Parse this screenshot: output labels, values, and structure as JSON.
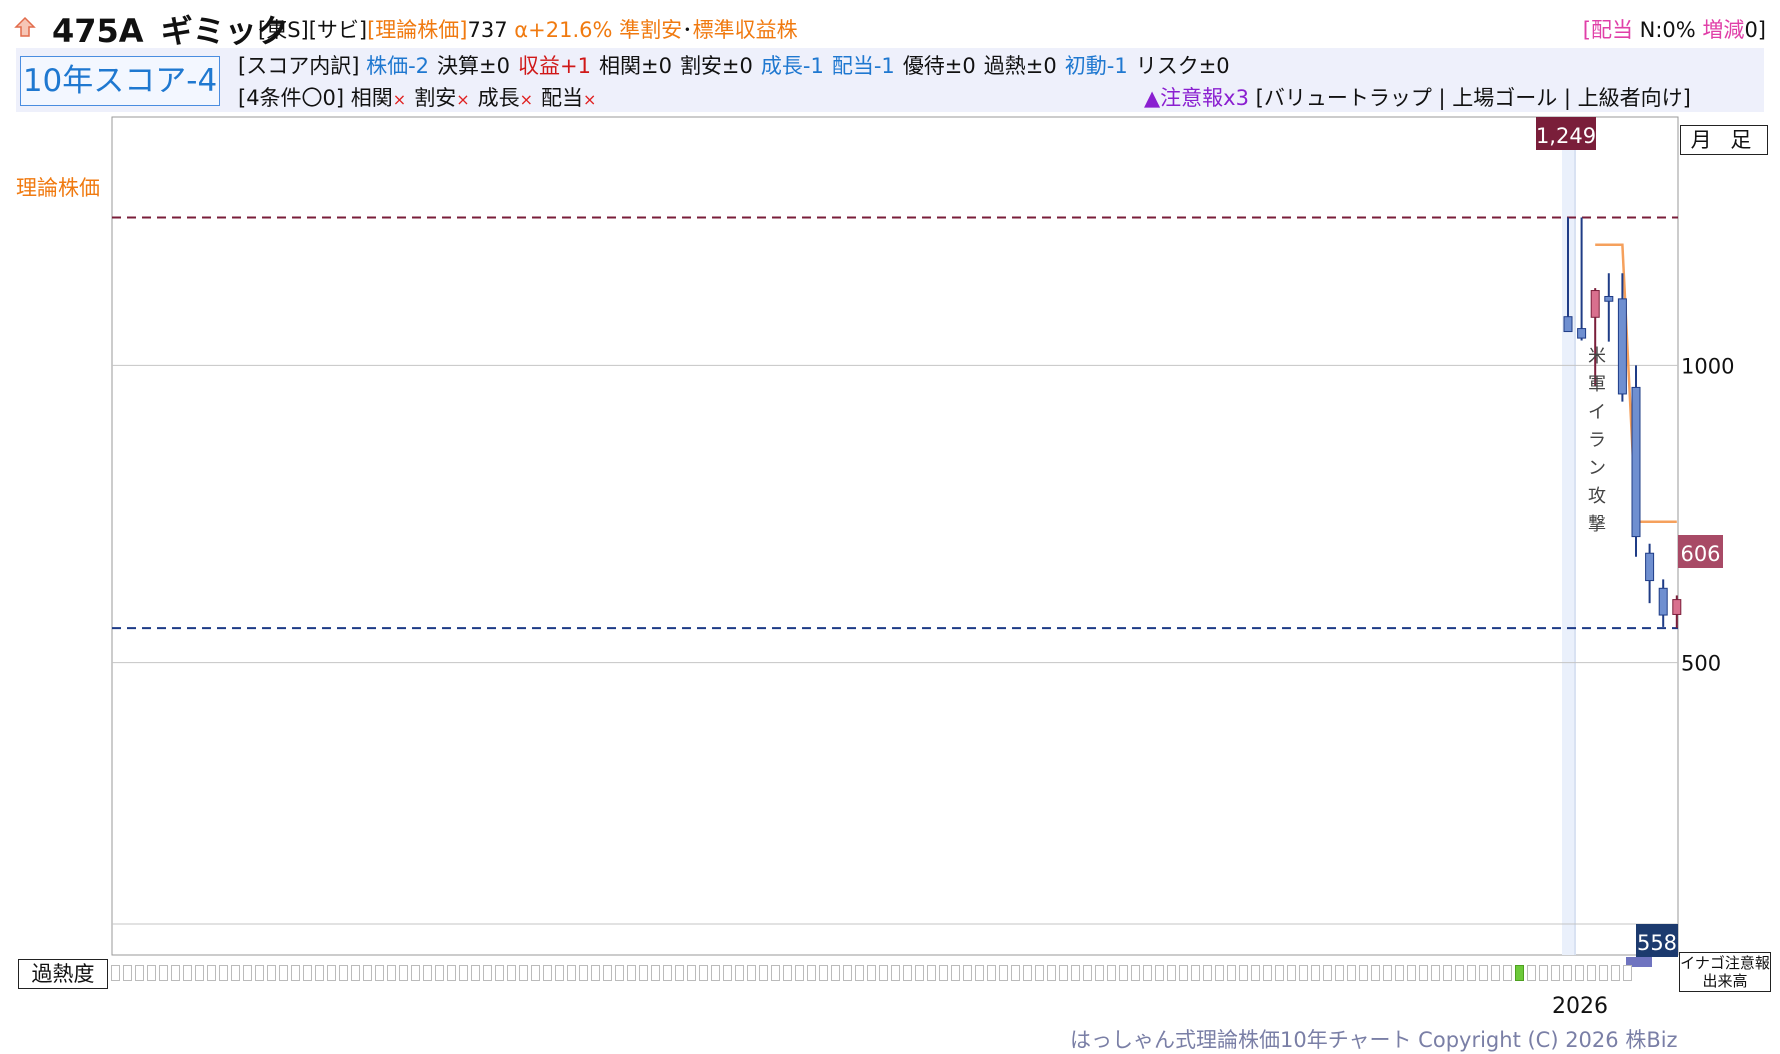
{
  "header": {
    "code": "475A",
    "name": "ギミック",
    "market": "[東S]",
    "sector": "[サビ]",
    "theory_label": "[理論株価]",
    "theory_value": "737",
    "alpha": "α+21.6%",
    "category1": "準割安",
    "dot": "･",
    "category2": "標準収益株"
  },
  "dividend": {
    "open": "[",
    "label": "配当",
    "value": " N:0%",
    "change_label": " 増減",
    "change_value": "0]"
  },
  "score": {
    "title": "10年スコア-4",
    "breakdown_label": "[スコア内訳]",
    "items": [
      {
        "label": "株価-2",
        "color": "#1f78d0"
      },
      {
        "label": "決算±0",
        "color": "#111111"
      },
      {
        "label": "収益+1",
        "color": "#d01818"
      },
      {
        "label": "相関±0",
        "color": "#111111"
      },
      {
        "label": "割安±0",
        "color": "#111111"
      },
      {
        "label": "成長-1",
        "color": "#1f78d0"
      },
      {
        "label": "配当-1",
        "color": "#1f78d0"
      },
      {
        "label": "優待±0",
        "color": "#111111"
      },
      {
        "label": "過熱±0",
        "color": "#111111"
      },
      {
        "label": "初動-1",
        "color": "#1f78d0"
      },
      {
        "label": "リスク±0",
        "color": "#111111"
      }
    ],
    "conditions_label": "[4条件〇0]",
    "conditions": [
      "相関",
      "割安",
      "成長",
      "配当"
    ],
    "x_mark": "×",
    "warning_label": "▲注意報x3",
    "warning_tags": "[バリュートラップ | 上場ゴール | 上級者向け]"
  },
  "chart_data": {
    "type": "candlestick",
    "timeframe": "月 足",
    "theory_price_label": "理論株価",
    "y_ticks": [
      1000,
      500
    ],
    "ylim": [
      8,
      1418
    ],
    "high_label": "1,249",
    "low_label": "558",
    "last_label": "606",
    "high_line": 1249,
    "low_line": 558,
    "year_label": "2026",
    "event_annotation": "米軍イラン攻撃",
    "candles": [
      {
        "o": 1082,
        "h": 1249,
        "l": 1062,
        "c": 1057
      },
      {
        "o": 1062,
        "h": 1249,
        "l": 1042,
        "c": 1046
      },
      {
        "o": 1081,
        "h": 1130,
        "l": 966,
        "c": 1126
      },
      {
        "o": 1116,
        "h": 1155,
        "l": 1040,
        "c": 1108
      },
      {
        "o": 1112,
        "h": 1155,
        "l": 939,
        "c": 952
      },
      {
        "o": 963,
        "h": 1000,
        "l": 678,
        "c": 712
      },
      {
        "o": 684,
        "h": 700,
        "l": 600,
        "c": 638
      },
      {
        "o": 625,
        "h": 640,
        "l": 560,
        "c": 580
      },
      {
        "o": 581,
        "h": 613,
        "l": 558,
        "c": 606
      }
    ],
    "theory_line": [
      {
        "i": 2,
        "v": 1203
      },
      {
        "i": 4,
        "v": 1203
      },
      {
        "i": 5,
        "v": 737
      },
      {
        "i": 8,
        "v": 737
      }
    ],
    "heat": {
      "count": 127,
      "on": [
        117
      ]
    },
    "volume_label": "イナゴ注意報\n出来高"
  },
  "footer": {
    "copyright": "はっしゃん式理論株価10年チャート Copyright (C) 2026 株Biz"
  }
}
